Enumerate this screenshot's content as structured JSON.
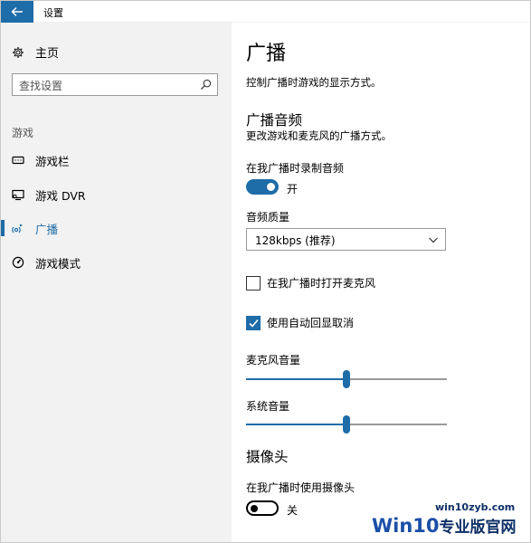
{
  "window": {
    "title": "设置"
  },
  "sidebar": {
    "home_label": "主页",
    "search_placeholder": "查找设置",
    "section_label": "游戏",
    "items": [
      {
        "label": "游戏栏",
        "icon": "keyboard-icon"
      },
      {
        "label": "游戏 DVR",
        "icon": "capture-icon"
      },
      {
        "label": "广播",
        "icon": "broadcast-icon",
        "active": true
      },
      {
        "label": "游戏模式",
        "icon": "game-mode-icon"
      }
    ]
  },
  "main": {
    "title": "广播",
    "description": "控制广播时游戏的显示方式。",
    "audio_section": {
      "heading": "广播音频",
      "description": "更改游戏和麦克风的广播方式。",
      "record_audio_label": "在我广播时录制音频",
      "record_audio_state": "开",
      "record_audio_on": true,
      "quality_label": "音频质量",
      "quality_value": "128kbps (推荐)",
      "mic_checkbox_label": "在我广播时打开麦克风",
      "mic_checked": false,
      "echo_checkbox_label": "使用自动回显取消",
      "echo_checked": true,
      "mic_volume_label": "麦克风音量",
      "mic_volume_level": 0.5,
      "system_volume_label": "系统音量",
      "system_volume_level": 0.5
    },
    "camera_section": {
      "heading": "摄像头",
      "camera_label": "在我广播时使用摄像头",
      "camera_state": "关",
      "camera_on": false
    }
  },
  "watermark": {
    "url": "win10zyb.com",
    "brand_en": "Win10",
    "brand_cn": "专业版官网"
  },
  "colors": {
    "accent": "#1e6ca8",
    "sidebar_bg": "#f2f2f2"
  }
}
